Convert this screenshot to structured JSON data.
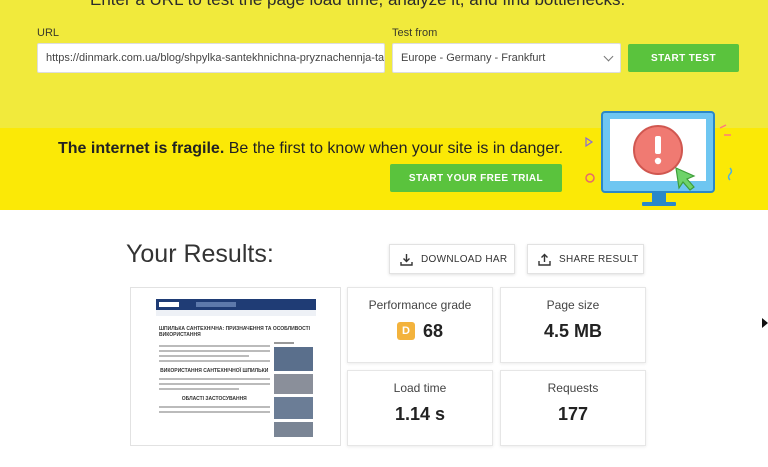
{
  "hero": {
    "headline": "Enter a URL to test the page load time, analyze it, and find bottlenecks.",
    "url_label": "URL",
    "url_value": "https://dinmark.com.ua/blog/shpylka-santekhnichna-pryznachennja-ta-osoblyvosti-vykorystannja",
    "test_from_label": "Test from",
    "test_from_value": "Europe - Germany - Frankfurt",
    "start_button": "START TEST"
  },
  "promo": {
    "bold": "The internet is fragile.",
    "rest": " Be the first to know when your site is in danger.",
    "trial_button": "START YOUR FREE TRIAL"
  },
  "results": {
    "title": "Your Results:",
    "download_label": "DOWNLOAD HAR",
    "share_label": "SHARE RESULT"
  },
  "metrics": {
    "performance": {
      "title": "Performance grade",
      "grade": "D",
      "value": "68"
    },
    "page_size": {
      "title": "Page size",
      "value": "4.5 MB"
    },
    "load_time": {
      "title": "Load time",
      "value": "1.14 s"
    },
    "requests": {
      "title": "Requests",
      "value": "177"
    }
  },
  "screenshot": {
    "heading": "ШПИЛЬКА САНТЕХНІЧНА: ПРИЗНАЧЕННЯ ТА ОСОБЛИВОСТІ ВИКОРИСТАННЯ",
    "subheading1": "ВИКОРИСТАННЯ САНТЕХНІЧНОЇ ШПИЛЬКИ",
    "subheading2": "ОБЛАСТІ ЗАСТОСУВАННЯ"
  },
  "colors": {
    "hero_bg": "#f1ea3c",
    "promo_bg": "#fbe906",
    "accent_green": "#5ac33d",
    "grade_d": "#f3b33d"
  }
}
